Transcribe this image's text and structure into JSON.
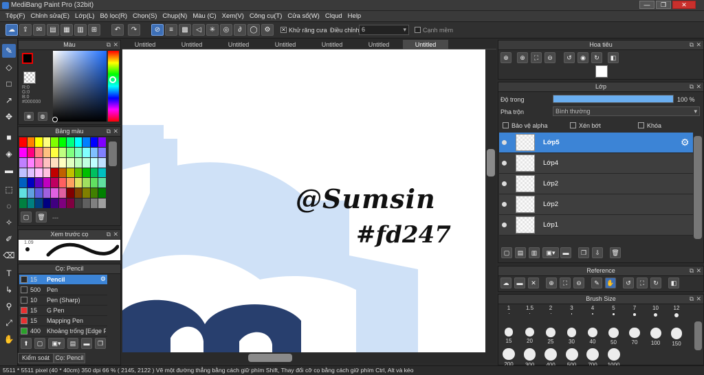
{
  "window": {
    "title": "MediBang Paint Pro (32bit)",
    "close_glyph": "✕",
    "min_glyph": "—",
    "max_glyph": "❐"
  },
  "menu": [
    "Tệp(F)",
    "Chỉnh sửa(E)",
    "Lớp(L)",
    "Bộ lọc(R)",
    "Chọn(S)",
    "Chụp(N)",
    "Màu (C)",
    "Xem(V)",
    "Công cụ(T)",
    "Cửa sổ(W)",
    "Clqud",
    "Help"
  ],
  "toolbar": {
    "antialias_label": "Khử răng cưa",
    "antialias_checked": "✕",
    "adjust_label": "Điều chỉnh",
    "adjust_value": "6",
    "snap_label": "Cạnh mềm"
  },
  "tabs": [
    "Untitled",
    "Untitled",
    "Untitled",
    "Untitled",
    "Untitled",
    "Untitled",
    "Untitled"
  ],
  "color_panel": {
    "title": "Màu",
    "r": "R:0",
    "g": "G:0",
    "b": "B:0",
    "hex": "#000000"
  },
  "palette_panel": {
    "title": "Bảng màu",
    "footer_text": "---"
  },
  "palette_colors": [
    "#ff0000",
    "#ff8000",
    "#ffff00",
    "#ffff80",
    "#80ff00",
    "#00ff00",
    "#00ff80",
    "#00ffff",
    "#0080ff",
    "#0000ff",
    "#8000ff",
    "#ff00ff",
    "#ff0080",
    "#ff8080",
    "#ffc080",
    "#ffff40",
    "#c0ff80",
    "#80ff80",
    "#80ffc0",
    "#80ffff",
    "#80c0ff",
    "#8080ff",
    "#c080ff",
    "#ff80ff",
    "#ff80c0",
    "#ffc0c0",
    "#ffe0c0",
    "#ffffc0",
    "#e0ffc0",
    "#c0ffc0",
    "#c0ffe0",
    "#c0ffff",
    "#c0e0ff",
    "#c0c0ff",
    "#e0c0ff",
    "#ffc0ff",
    "#ffc0e0",
    "#c00000",
    "#c06000",
    "#c0c000",
    "#60c000",
    "#00c000",
    "#00c060",
    "#00c0c0",
    "#0060c0",
    "#0000c0",
    "#6000c0",
    "#c000c0",
    "#c00060",
    "#ff6060",
    "#ffa060",
    "#e0e060",
    "#a0e060",
    "#60e060",
    "#60e0a0",
    "#60e0e0",
    "#60a0e0",
    "#6060e0",
    "#a060e0",
    "#e060e0",
    "#e060a0",
    "#800000",
    "#804000",
    "#808000",
    "#408000",
    "#008000",
    "#008040",
    "#008080",
    "#004080",
    "#000080",
    "#400080",
    "#800080",
    "#800040",
    "#404040",
    "#606060",
    "#808080",
    "#a0a0a0"
  ],
  "preview_panel": {
    "title": "Xem trước cọ",
    "size": "1.09"
  },
  "brush_panel": {
    "title": "Cọ: Pencil",
    "brushes": [
      {
        "size": "15",
        "name": "Pencil",
        "color": "#2a2a2a"
      },
      {
        "size": "500",
        "name": "Pen",
        "color": "#2a2a2a"
      },
      {
        "size": "10",
        "name": "Pen (Sharp)",
        "color": "#2a2a2a"
      },
      {
        "size": "15",
        "name": "G Pen",
        "color": "#e83030"
      },
      {
        "size": "15",
        "name": "Mapping Pen",
        "color": "#e83030"
      },
      {
        "size": "400",
        "name": "Khoảng trống [Edge Fill]",
        "color": "#2aa02a"
      }
    ],
    "tab_control": "Kiểm soát cọ",
    "tab_brush": "Cọ: Pencil"
  },
  "navigator": {
    "title": "Hoa tiêu"
  },
  "layer_panel": {
    "title": "Lớp",
    "opacity_label": "Độ trong",
    "opacity_value": "100 %",
    "opacity": 1.0,
    "blend_label": "Pha trộn",
    "blend_value": "Bình thường",
    "protect_alpha": "Bảo vệ alpha",
    "clipping": "Xén bớt",
    "lock": "Khóa",
    "layers": [
      "Lớp5",
      "Lớp4",
      "Lớp2",
      "Lớp2",
      "Lớp1"
    ]
  },
  "reference_panel": {
    "title": "Reference"
  },
  "brush_size_panel": {
    "title": "Brush Size",
    "sizes": [
      "1",
      "1.5",
      "2",
      "3",
      "4",
      "5",
      "7",
      "10",
      "12",
      "15",
      "20",
      "25",
      "30",
      "40",
      "50",
      "70",
      "100",
      "150",
      "200",
      "300",
      "400",
      "500",
      "700",
      "1000"
    ]
  },
  "canvas": {
    "text_line1": "@Sumsin",
    "text_line2": "#fd247"
  },
  "status": "5511 * 5511 pixel   (40 * 40cm)   350 dpi   66 %   ( 2145, 2122 )   Vẽ một đường thẳng bằng cách giữ phím Shift, Thay đổi cỡ cọ bằng cách giữ phím Ctrl, Alt và kéo"
}
